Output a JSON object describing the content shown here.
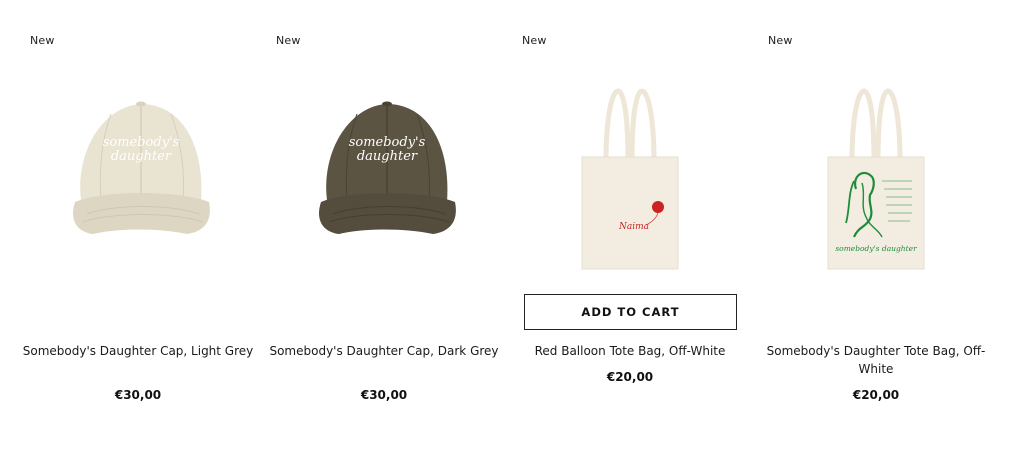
{
  "products": [
    {
      "badge": "New",
      "title": "Somebody's Daughter Cap, Light Grey",
      "price": "€30,00",
      "image_text_line1": "somebody's",
      "image_text_line2": "daughter",
      "image_icon": "light-cap-image",
      "colors": {
        "cap": "#e9e3d2",
        "shade": "#d9d2bf",
        "print": "#ffffff"
      }
    },
    {
      "badge": "New",
      "title": "Somebody's Daughter Cap, Dark Grey",
      "price": "€30,00",
      "image_text_line1": "somebody's",
      "image_text_line2": "daughter",
      "image_icon": "dark-cap-image",
      "colors": {
        "cap": "#5c5443",
        "shade": "#4a4335",
        "print": "#ffffff"
      }
    },
    {
      "badge": "New",
      "title": "Red Balloon Tote Bag, Off-White",
      "price": "€20,00",
      "add_to_cart": "ADD TO CART",
      "image_text_line1": "Naima",
      "image_icon": "red-balloon-tote-image",
      "colors": {
        "bag": "#f3ede1",
        "print": "#cc2222"
      }
    },
    {
      "badge": "New",
      "title": "Somebody's Daughter Tote Bag, Off-White",
      "price": "€20,00",
      "image_text_line1": "somebody's daughter",
      "image_icon": "daughter-tote-image",
      "colors": {
        "bag": "#f3ede1",
        "print": "#1e8c3a"
      }
    }
  ]
}
